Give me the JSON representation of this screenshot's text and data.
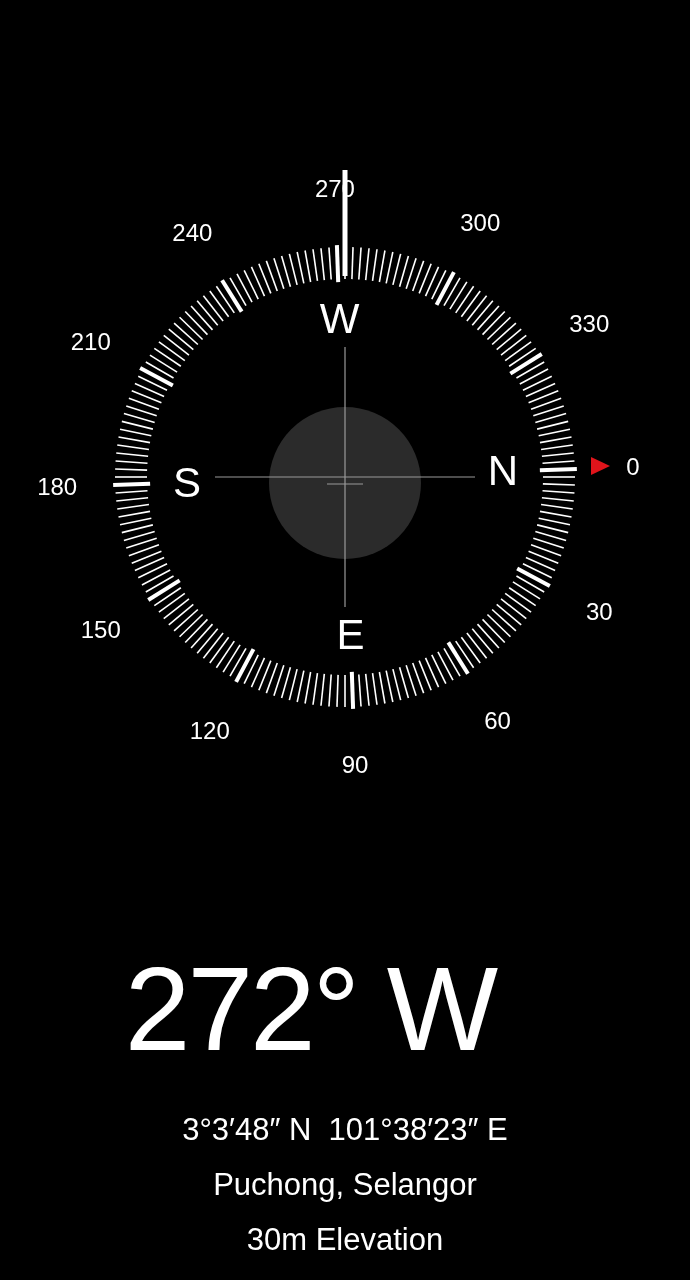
{
  "dial": {
    "degree_labels": [
      "0",
      "30",
      "60",
      "90",
      "120",
      "150",
      "180",
      "210",
      "240",
      "270",
      "300",
      "330"
    ],
    "cardinal_labels": [
      "N",
      "E",
      "S",
      "W"
    ]
  },
  "heading": "272° W",
  "coordinates": "3°3′48″ N  101°38′23″ E",
  "location": "Puchong, Selangor",
  "elevation": "30m Elevation"
}
